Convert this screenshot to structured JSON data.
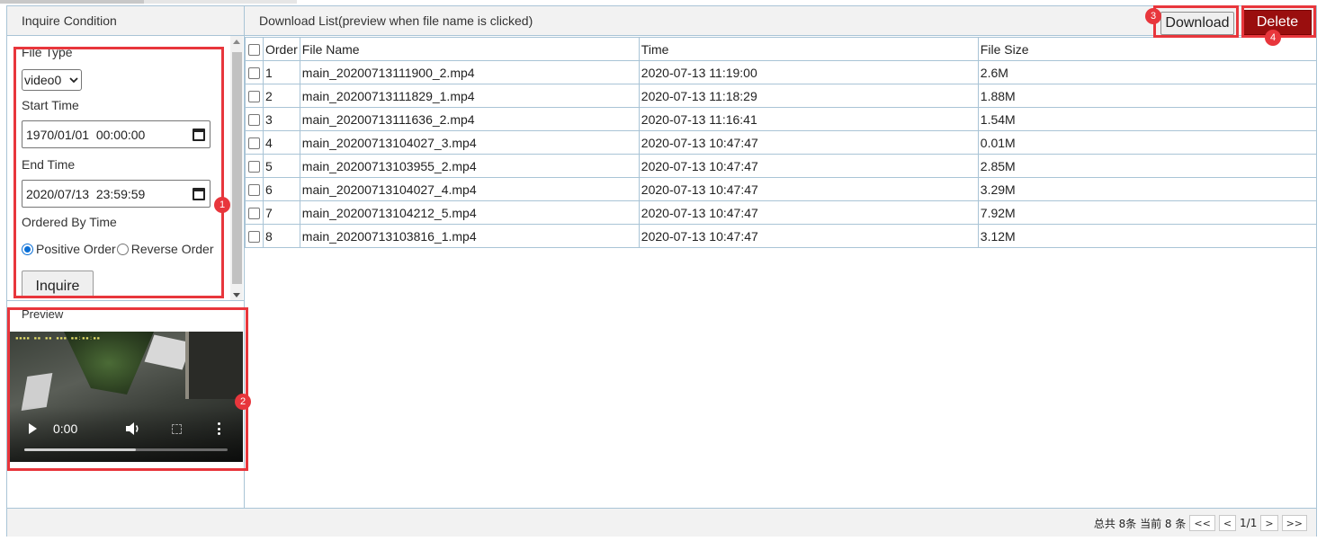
{
  "condition_panel": {
    "title": "Inquire Condition",
    "file_type_label": "File Type",
    "file_type_value": "video0",
    "start_time_label": "Start Time",
    "start_time_value": "1970/01/01  00:00:00",
    "end_time_label": "End Time",
    "end_time_value": "2020/07/13  23:59:59",
    "order_label": "Ordered By Time",
    "order_options": [
      "Positive Order",
      "Reverse Order"
    ],
    "order_selected": "Positive Order",
    "inquire_label": "Inquire"
  },
  "preview": {
    "label": "Preview",
    "video_time": "0:00",
    "playback_progress": 0.55
  },
  "download_list": {
    "title": "Download List(preview when file name is clicked)",
    "download_label": "Download",
    "delete_label": "Delete",
    "delete_color": "#9a0e0e",
    "columns": [
      "Order",
      "File Name",
      "Time",
      "File Size"
    ],
    "rows": [
      {
        "order": "1",
        "name": "main_20200713111900_2.mp4",
        "time": "2020-07-13 11:19:00",
        "size": "2.6M"
      },
      {
        "order": "2",
        "name": "main_20200713111829_1.mp4",
        "time": "2020-07-13 11:18:29",
        "size": "1.88M"
      },
      {
        "order": "3",
        "name": "main_20200713111636_2.mp4",
        "time": "2020-07-13 11:16:41",
        "size": "1.54M"
      },
      {
        "order": "4",
        "name": "main_20200713104027_3.mp4",
        "time": "2020-07-13 10:47:47",
        "size": "0.01M"
      },
      {
        "order": "5",
        "name": "main_20200713103955_2.mp4",
        "time": "2020-07-13 10:47:47",
        "size": "2.85M"
      },
      {
        "order": "6",
        "name": "main_20200713104027_4.mp4",
        "time": "2020-07-13 10:47:47",
        "size": "3.29M"
      },
      {
        "order": "7",
        "name": "main_20200713104212_5.mp4",
        "time": "2020-07-13 10:47:47",
        "size": "7.92M"
      },
      {
        "order": "8",
        "name": "main_20200713103816_1.mp4",
        "time": "2020-07-13 10:47:47",
        "size": "3.12M"
      }
    ]
  },
  "pager": {
    "summary": "总共 8条 当前 8 条",
    "first": "<<",
    "prev": "<",
    "page": "1/1",
    "next": ">",
    "last": ">>"
  },
  "annotations": {
    "color": "#e8363c",
    "badges": [
      "1",
      "2",
      "3",
      "4"
    ]
  }
}
